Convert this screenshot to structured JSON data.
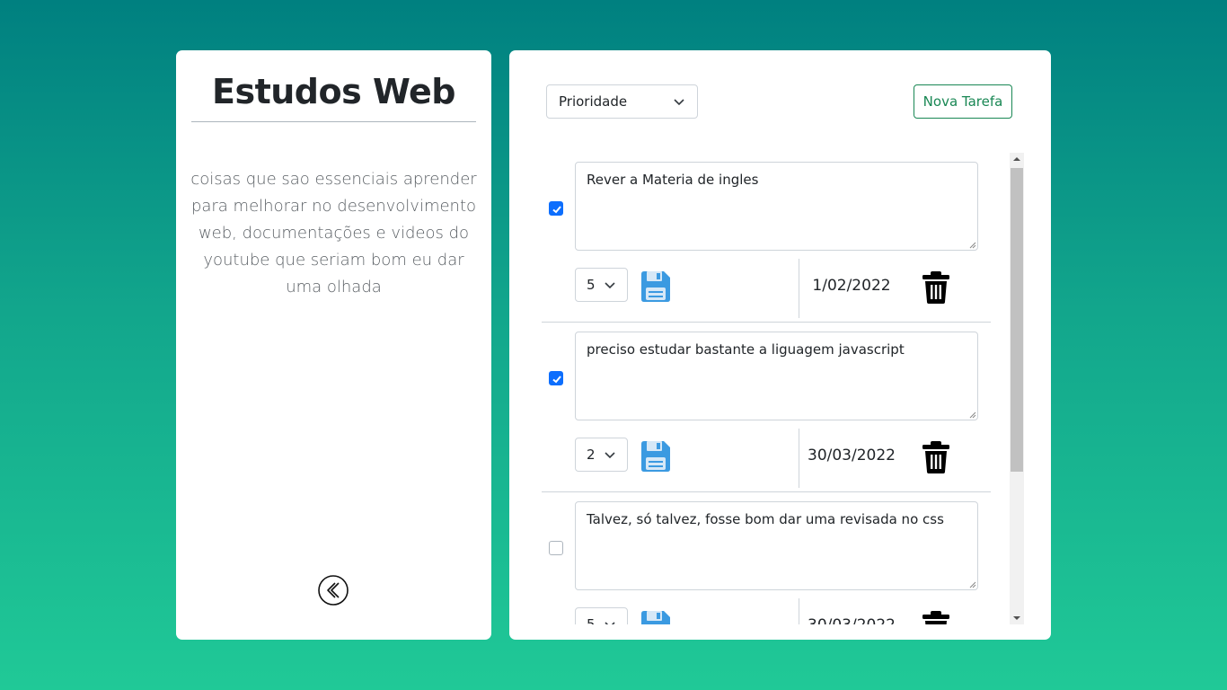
{
  "left": {
    "title": "Estudos Web",
    "description": "coisas que sao essenciais aprender para melhorar no desenvolvimento web, documentações e videos do youtube que seriam bom eu dar uma olhada",
    "back_icon": "chevron-left-circle-icon"
  },
  "toolbar": {
    "priority_select": "Prioridade",
    "new_task_label": "Nova Tarefa"
  },
  "tasks": [
    {
      "text": "Rever a Materia de ingles",
      "checked": true,
      "priority": "5",
      "date": "1/02/2022"
    },
    {
      "text": "preciso estudar bastante a liguagem javascript",
      "checked": true,
      "priority": "2",
      "date": "30/03/2022"
    },
    {
      "text": "Talvez, só talvez, fosse bom dar uma revisada no css",
      "checked": false,
      "priority": "5",
      "date": "30/03/2022"
    }
  ],
  "colors": {
    "accent": "#198754",
    "checkbox": "#0d6efd",
    "save_icon": "#3b9ae1"
  }
}
